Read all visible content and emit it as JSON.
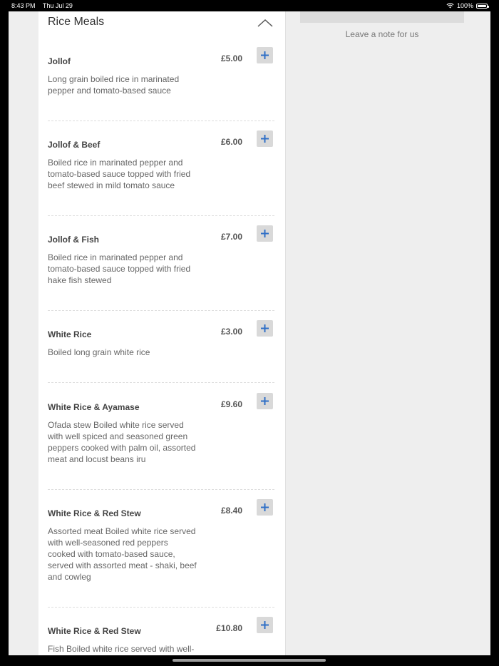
{
  "status_bar": {
    "time": "8:43 PM",
    "date": "Thu Jul 29",
    "battery": "100%"
  },
  "section": {
    "title": "Rice Meals"
  },
  "items": [
    {
      "name": "Jollof",
      "price": "£5.00",
      "description": "Long grain boiled rice in marinated pepper and tomato-based sauce"
    },
    {
      "name": "Jollof & Beef",
      "price": "£6.00",
      "description": "Boiled rice in marinated pepper and tomato-based sauce topped with fried beef stewed in mild tomato sauce"
    },
    {
      "name": "Jollof & Fish",
      "price": "£7.00",
      "description": "Boiled rice in marinated pepper and tomato-based sauce topped with fried hake fish stewed"
    },
    {
      "name": "White Rice",
      "price": "£3.00",
      "description": "Boiled long grain white rice"
    },
    {
      "name": "White Rice & Ayamase",
      "price": "£9.60",
      "description": "Ofada stew Boiled white rice served with well spiced and seasoned green peppers cooked with palm oil, assorted meat and locust beans iru"
    },
    {
      "name": "White Rice & Red Stew",
      "price": "£8.40",
      "description": "Assorted meat Boiled white rice served with well-seasoned red peppers cooked with tomato-based sauce, served with assorted meat - shaki, beef and cowleg"
    },
    {
      "name": "White Rice & Red Stew",
      "price": "£10.80",
      "description": "Fish Boiled white rice served with well-"
    }
  ],
  "note": {
    "label": "Leave a note for us"
  },
  "icons": {
    "add": "plus-icon",
    "collapse": "chevron-up-icon",
    "wifi": "wifi-icon",
    "battery": "battery-icon"
  },
  "colors": {
    "accent": "#2f6fc6",
    "button_bg": "#d9d9d9",
    "background": "#eeeeee"
  }
}
